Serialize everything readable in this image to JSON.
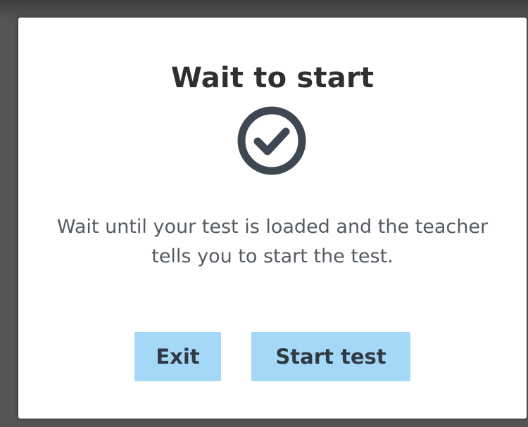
{
  "dialog": {
    "title": "Wait to start",
    "status_icon": "check-circle-icon",
    "message": "Wait until your test is loaded and the teacher tells you to start the test.",
    "buttons": {
      "exit_label": "Exit",
      "start_label": "Start test"
    }
  },
  "colors": {
    "button_bg": "#a5d8f7",
    "icon": "#3d4852",
    "title": "#2f2f2f",
    "message": "#555b61",
    "backdrop": "#555555"
  }
}
